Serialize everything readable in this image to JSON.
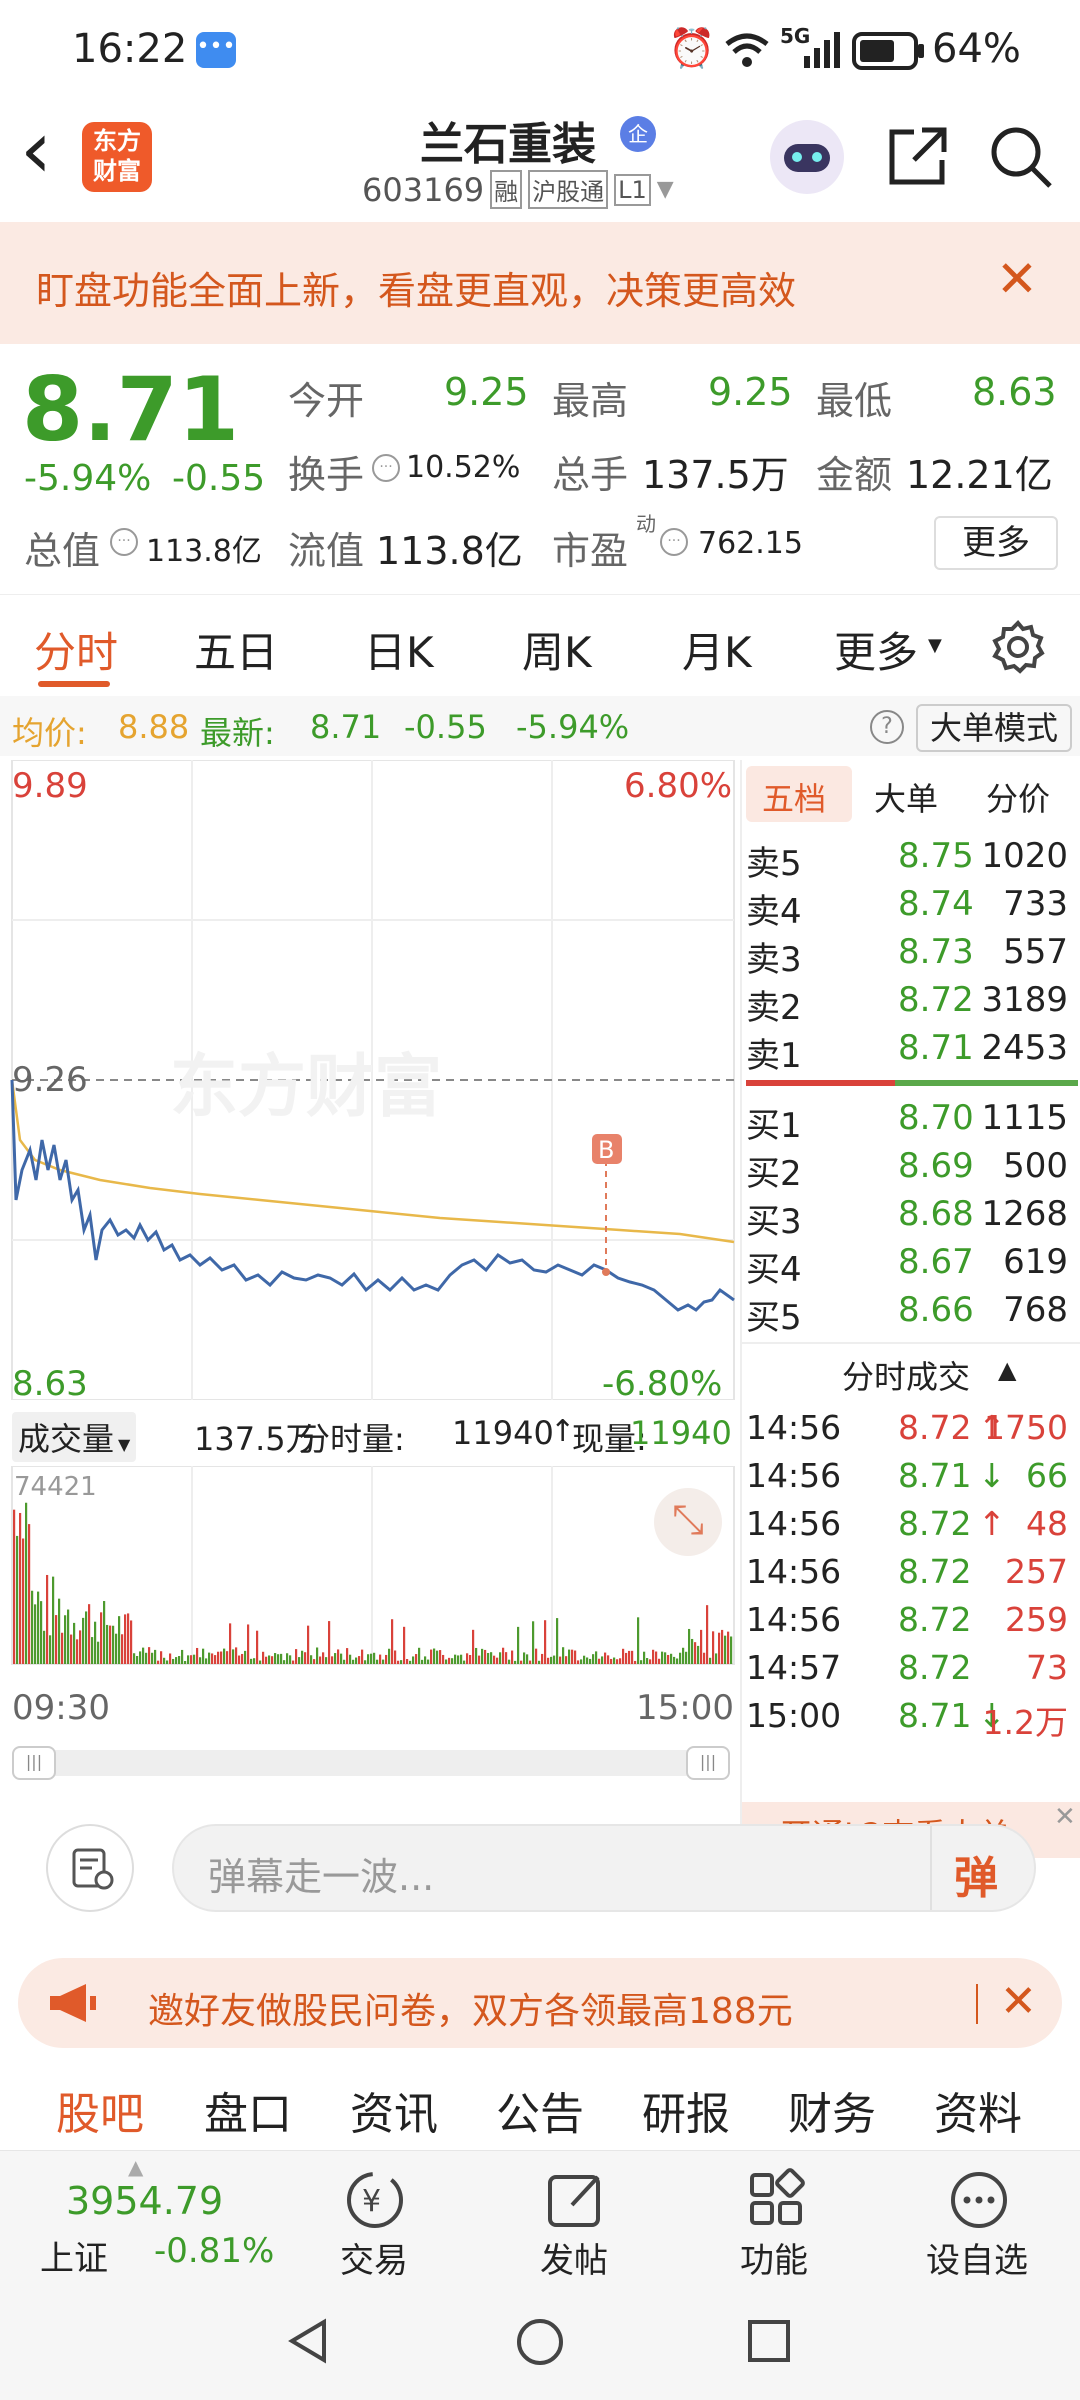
{
  "status_bar": {
    "time": "16:22",
    "battery": "64%",
    "network": "5G"
  },
  "header": {
    "back": "‹",
    "logo_line1": "东方",
    "logo_line2": "财富",
    "stock_name": "兰石重装",
    "badge": "企",
    "code": "603169",
    "tag1": "融",
    "tag2": "沪股通",
    "tag3": "L1"
  },
  "banner": {
    "text": "盯盘功能全面上新，看盘更直观，决策更高效"
  },
  "quote": {
    "price": "8.71",
    "change_pct": "-5.94%",
    "change": "-0.55",
    "open_label": "今开",
    "open": "9.25",
    "high_label": "最高",
    "high": "9.25",
    "low_label": "最低",
    "low": "8.63",
    "turnover_label": "换手",
    "turnover": "10.52%",
    "volume_label": "总手",
    "volume": "137.5万",
    "amount_label": "金额",
    "amount": "12.21亿",
    "mktcap_label": "总值",
    "mktcap": "113.8亿",
    "float_label": "流值",
    "float": "113.8亿",
    "pe_label": "市盈",
    "pe_sup": "动",
    "pe": "762.15",
    "more": "更多"
  },
  "chart_tabs": [
    "分时",
    "五日",
    "日K",
    "周K",
    "月K",
    "更多"
  ],
  "info_line": {
    "avg_label": "均价:",
    "avg": "8.88",
    "latest_label": "最新:",
    "latest": "8.71",
    "change": "-0.55",
    "pct": "-5.94%",
    "big_mode": "大单模式"
  },
  "price_axis": {
    "top": "9.89",
    "top_pct": "6.80%",
    "mid": "9.26",
    "bottom": "8.63",
    "bottom_pct": "-6.80%",
    "watermark": "东方财富",
    "marker": "B"
  },
  "volume_bar": {
    "label": "成交量",
    "total": "137.5万",
    "tick_label": "分时量:",
    "tick": "11940",
    "now_label": "现量:",
    "now": "11940",
    "max": "74421"
  },
  "time_axis": {
    "start": "09:30",
    "end": "15:00"
  },
  "orderbook_tabs": [
    "五档",
    "大单",
    "分价"
  ],
  "asks": [
    {
      "l": "卖5",
      "p": "8.75",
      "v": "1020"
    },
    {
      "l": "卖4",
      "p": "8.74",
      "v": "733"
    },
    {
      "l": "卖3",
      "p": "8.73",
      "v": "557"
    },
    {
      "l": "卖2",
      "p": "8.72",
      "v": "3189"
    },
    {
      "l": "卖1",
      "p": "8.71",
      "v": "2453"
    }
  ],
  "bids": [
    {
      "l": "买1",
      "p": "8.70",
      "v": "1115"
    },
    {
      "l": "买2",
      "p": "8.69",
      "v": "500"
    },
    {
      "l": "买3",
      "p": "8.68",
      "v": "1268"
    },
    {
      "l": "买4",
      "p": "8.67",
      "v": "619"
    },
    {
      "l": "买5",
      "p": "8.66",
      "v": "768"
    }
  ],
  "trades_title": "分时成交",
  "trades": [
    {
      "t": "14:56",
      "p": "8.72",
      "d": "↑",
      "v": "1750"
    },
    {
      "t": "14:56",
      "p": "8.71",
      "d": "↓",
      "v": "66"
    },
    {
      "t": "14:56",
      "p": "8.72",
      "d": "↑",
      "v": "48"
    },
    {
      "t": "14:56",
      "p": "8.72",
      "d": "",
      "v": "257"
    },
    {
      "t": "14:56",
      "p": "8.72",
      "d": "",
      "v": "259"
    },
    {
      "t": "14:57",
      "p": "8.72",
      "d": "",
      "v": "73"
    },
    {
      "t": "15:00",
      "p": "8.71",
      "d": "↓",
      "v": "1.2万"
    }
  ],
  "l2_promo": "开通L2查看大单",
  "danmu": {
    "placeholder": "弹幕走一波...",
    "send": "弹"
  },
  "invite": {
    "text": "邀好友做股民问卷，双方各领最高188元"
  },
  "subtabs": [
    "股吧",
    "盘口",
    "资讯",
    "公告",
    "研报",
    "财务",
    "资料"
  ],
  "index": {
    "value": "3954.79",
    "name": "上证",
    "pct": "-0.81%"
  },
  "bottom_nav": [
    "交易",
    "发帖",
    "功能",
    "设自选"
  ]
}
